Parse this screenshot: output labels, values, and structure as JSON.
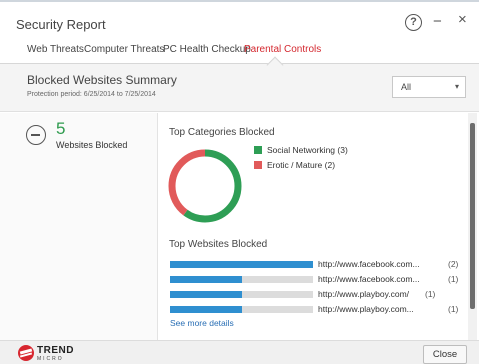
{
  "window": {
    "title": "Security Report",
    "help_glyph": "?",
    "minimize_glyph": "−",
    "close_glyph": "×"
  },
  "tabs": [
    {
      "label": "Web Threats",
      "active": false
    },
    {
      "label": "Computer Threats",
      "active": false
    },
    {
      "label": "PC Health Checkup",
      "active": false
    },
    {
      "label": "Parental Controls",
      "active": true
    }
  ],
  "summary": {
    "title": "Blocked Websites Summary",
    "period": "Protection period: 6/25/2014 to 7/25/2014",
    "filter_value": "All",
    "filter_arrow": "▾"
  },
  "stats": {
    "blocked_count": "5",
    "blocked_label": "Websites Blocked",
    "icon": "block-icon"
  },
  "categories": {
    "heading": "Top Categories Blocked",
    "items": [
      {
        "label": "Social Networking",
        "count": "(3)",
        "value": 3,
        "color": "#2e9e55"
      },
      {
        "label": "Erotic / Mature",
        "count": "(2)",
        "value": 2,
        "color": "#e15a5a"
      }
    ]
  },
  "websites": {
    "heading": "Top Websites Blocked",
    "items": [
      {
        "url": "http://www.facebook.com...",
        "count": "(2)",
        "fraction": 1.0
      },
      {
        "url": "http://www.facebook.com...",
        "count": "(1)",
        "fraction": 0.5
      },
      {
        "url": "http://www.playboy.com/",
        "count": "(1)",
        "fraction": 0.5
      },
      {
        "url": "http://www.playboy.com...",
        "count": "(1)",
        "fraction": 0.5
      }
    ],
    "see_more": "See more details"
  },
  "colors": {
    "accent_red": "#d4282f",
    "bar_blue": "#2f8fd0",
    "stat_green": "#2e9b4e"
  },
  "footer": {
    "logo_text": "TREND",
    "logo_sub": "MICRO",
    "close_label": "Close"
  }
}
